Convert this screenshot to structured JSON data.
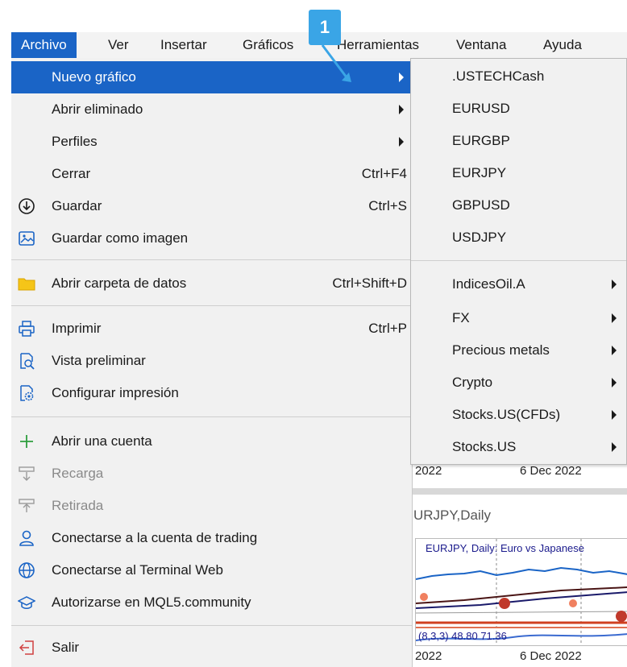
{
  "menubar": {
    "items": [
      {
        "label": "Archivo"
      },
      {
        "label": "Ver"
      },
      {
        "label": "Insertar"
      },
      {
        "label": "Gráficos"
      },
      {
        "label": "Herramientas"
      },
      {
        "label": "Ventana"
      },
      {
        "label": "Ayuda"
      }
    ]
  },
  "badge": {
    "number": "1"
  },
  "file_menu": {
    "items": [
      {
        "label": "Nuevo gráfico",
        "shortcut": "",
        "icon": "none"
      },
      {
        "label": "Abrir eliminado",
        "shortcut": "",
        "icon": "none"
      },
      {
        "label": "Perfiles",
        "shortcut": "",
        "icon": "none"
      },
      {
        "label": "Cerrar",
        "shortcut": "Ctrl+F4",
        "icon": "none"
      },
      {
        "label": "Guardar",
        "shortcut": "Ctrl+S",
        "icon": "download-circle-icon"
      },
      {
        "label": "Guardar como imagen",
        "shortcut": "",
        "icon": "image-icon"
      },
      {
        "label": "Abrir carpeta de datos",
        "shortcut": "Ctrl+Shift+D",
        "icon": "folder-icon"
      },
      {
        "label": "Imprimir",
        "shortcut": "Ctrl+P",
        "icon": "printer-icon"
      },
      {
        "label": "Vista preliminar",
        "shortcut": "",
        "icon": "preview-icon"
      },
      {
        "label": "Configurar impresión",
        "shortcut": "",
        "icon": "print-settings-icon"
      },
      {
        "label": "Abrir una cuenta",
        "shortcut": "",
        "icon": "plus-icon"
      },
      {
        "label": "Recarga",
        "shortcut": "",
        "icon": "deposit-icon"
      },
      {
        "label": "Retirada",
        "shortcut": "",
        "icon": "withdraw-icon"
      },
      {
        "label": "Conectarse a la cuenta de trading",
        "shortcut": "",
        "icon": "user-icon"
      },
      {
        "label": "Conectarse al Terminal Web",
        "shortcut": "",
        "icon": "globe-icon"
      },
      {
        "label": "Autorizarse en MQL5.community",
        "shortcut": "",
        "icon": "graduation-cap-icon"
      },
      {
        "label": "Salir",
        "shortcut": "",
        "icon": "exit-icon"
      }
    ]
  },
  "submenu": {
    "items": [
      {
        "label": ".USTECHCash"
      },
      {
        "label": "EURUSD"
      },
      {
        "label": "EURGBP"
      },
      {
        "label": "EURJPY"
      },
      {
        "label": "GBPUSD"
      },
      {
        "label": "USDJPY"
      },
      {
        "label": "IndicesOil.A"
      },
      {
        "label": "FX"
      },
      {
        "label": "Precious metals"
      },
      {
        "label": "Crypto"
      },
      {
        "label": "Stocks.US(CFDs)"
      },
      {
        "label": "Stocks.US"
      }
    ]
  },
  "background_chart": {
    "date_left_top": "2022",
    "date_right_top": "6 Dec 2022",
    "window_title": "URJPY,Daily",
    "chart_label": "EURJPY, Daily:  Euro vs Japanese",
    "indicator_text": "(8,3,3) 48.80 71.36",
    "date_left_bottom": "2022",
    "date_right_bottom": "6 Dec 2022"
  },
  "colors": {
    "accent": "#1a64c6",
    "badge": "#3aa5e6",
    "menu_bg": "#f1f1f1"
  }
}
